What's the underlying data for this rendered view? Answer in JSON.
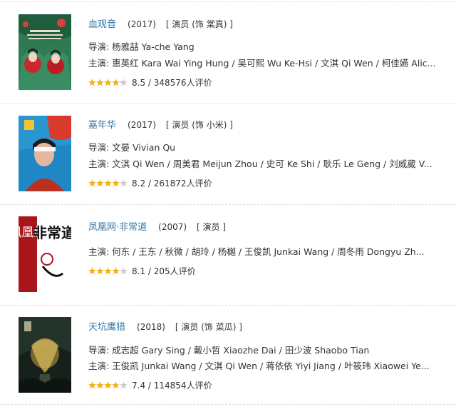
{
  "items": [
    {
      "title": "血观音",
      "year": "(2017)",
      "role": "[ 演员 (饰 棠真) ]",
      "director": "导演: 杨雅喆 Ya-che Yang",
      "cast": "主演: 惠英红 Kara Wai Ying Hung / 吴可熙 Wu Ke-Hsi / 文淇 Qi Wen / 柯佳嬿 Alic...",
      "rating_value": 0.85,
      "rating_text": "8.5 / 348576人评价",
      "poster_icon": "movie-poster"
    },
    {
      "title": "嘉年华",
      "year": "(2017)",
      "role": "[ 演员 (饰 小米) ]",
      "director": "导演: 文晏 Vivian Qu",
      "cast": "主演: 文淇 Qi Wen / 周美君 Meijun Zhou / 史可 Ke Shi / 耿乐 Le Geng / 刘威葳 V...",
      "rating_value": 0.82,
      "rating_text": "8.2 / 261872人评价",
      "poster_icon": "movie-poster"
    },
    {
      "title": "凤凰网·非常道",
      "year": "(2007)",
      "role": "[ 演员 ]",
      "director": "",
      "cast": "主演: 何东 / 王东 / 秋微 / 胡玲 / 杨樾 / 王俊凯 Junkai Wang / 周冬雨 Dongyu Zh...",
      "rating_value": 0.81,
      "rating_text": "8.1 / 205人评价",
      "poster_text_1": "鳳凰網",
      "poster_text_2": "非常道",
      "poster_icon": "show-poster"
    },
    {
      "title": "天坑鹰猎",
      "year": "(2018)",
      "role": "[ 演员 (饰 菜瓜) ]",
      "director": "导演: 成志超 Gary Sing / 戴小哲 Xiaozhe Dai / 田少波 Shaobo Tian",
      "cast": "主演: 王俊凯 Junkai Wang / 文淇 Qi Wen / 蒋依依 Yiyi Jiang / 叶筱玮 Xiaowei Ye...",
      "rating_value": 0.74,
      "rating_text": "7.4 / 114854人评价",
      "poster_icon": "movie-poster"
    }
  ],
  "colors": {
    "link": "#3377aa",
    "star_on": "#f5b30f",
    "star_off": "#cccccc",
    "text": "#333333"
  }
}
